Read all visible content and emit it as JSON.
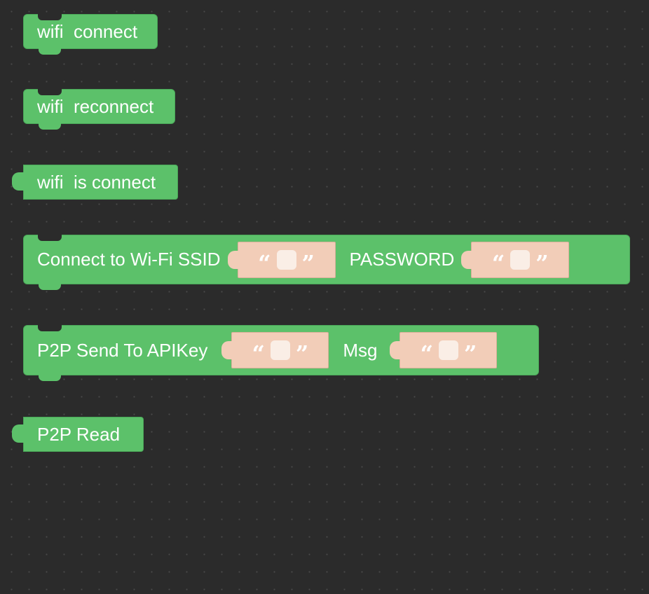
{
  "blocks": {
    "wifi_connect": {
      "label": "wifi  connect"
    },
    "wifi_reconnect": {
      "label": "wifi  reconnect"
    },
    "wifi_is_connect": {
      "label": "wifi  is connect"
    },
    "connect_wifi": {
      "label": "Connect to Wi-Fi SSID",
      "ssid": {
        "open_quote": "“",
        "close_quote": "”",
        "value": ""
      },
      "password_label": "PASSWORD",
      "password": {
        "open_quote": "“",
        "close_quote": "”",
        "value": ""
      }
    },
    "p2p_send": {
      "label": "P2P Send To APIKey",
      "apikey": {
        "open_quote": "“",
        "close_quote": "”",
        "value": ""
      },
      "msg_label": "Msg",
      "msg": {
        "open_quote": "“",
        "close_quote": "”",
        "value": ""
      }
    },
    "p2p_read": {
      "label": "P2P Read"
    }
  },
  "colors": {
    "workspace_bg": "#2b2b2b",
    "block_green": "#5cc16a",
    "text_slot": "#f2cdb8",
    "text_box": "#faeee6"
  }
}
